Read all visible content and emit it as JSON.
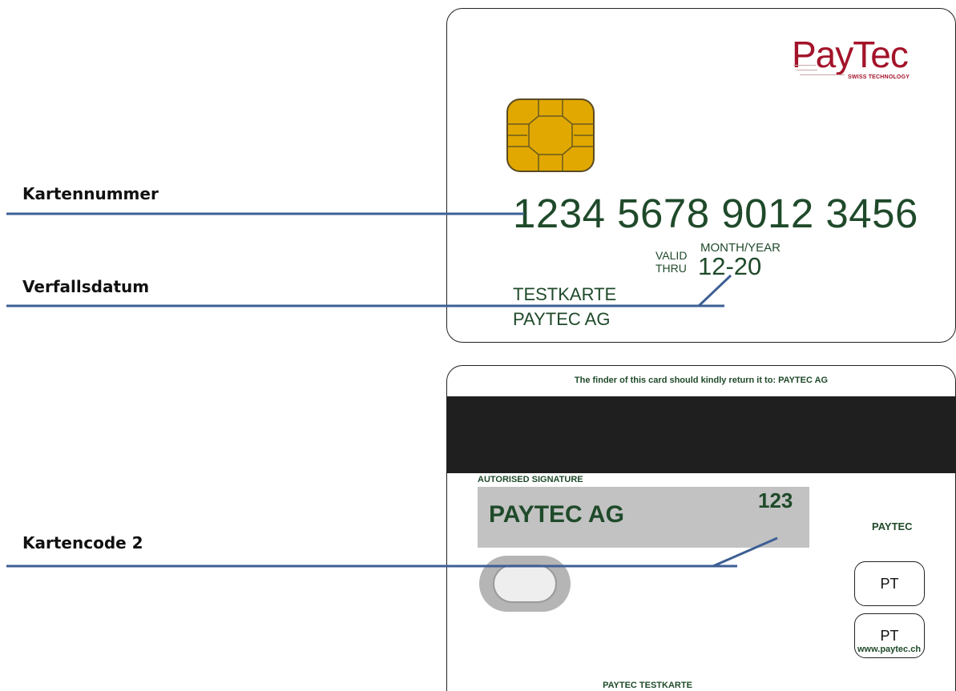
{
  "labels": {
    "card_number": "Kartennummer",
    "expiry": "Verfallsdatum",
    "cvc": "Kartencode 2"
  },
  "front": {
    "logo_text": "PayTec",
    "logo_sub": "SWISS TECHNOLOGY",
    "card_number": "1234 5678 9012 3456",
    "valid_line1": "VALID",
    "valid_line2": "THRU",
    "month_year": "MONTH/YEAR",
    "expiry": "12-20",
    "holder_line1": "TESTKARTE",
    "holder_line2": "PAYTEC AG"
  },
  "back": {
    "finder_text": "The finder of this card should kindly return it to: PAYTEC AG",
    "signature_label": "AUTORISED SIGNATURE",
    "signature_name": "PAYTEC AG",
    "cvc": "123",
    "brand": "PAYTEC",
    "box1": "PT",
    "box2": "PT",
    "website": "www.paytec.ch",
    "footer": "PAYTEC TESTKARTE"
  },
  "colors": {
    "leader_line": "#3d5f94",
    "card_text": "#1f4a2a",
    "logo": "#a3132a",
    "chip": "#e0a800",
    "stripe": "#1f1f1f",
    "signature_panel": "#c2c2c2"
  }
}
